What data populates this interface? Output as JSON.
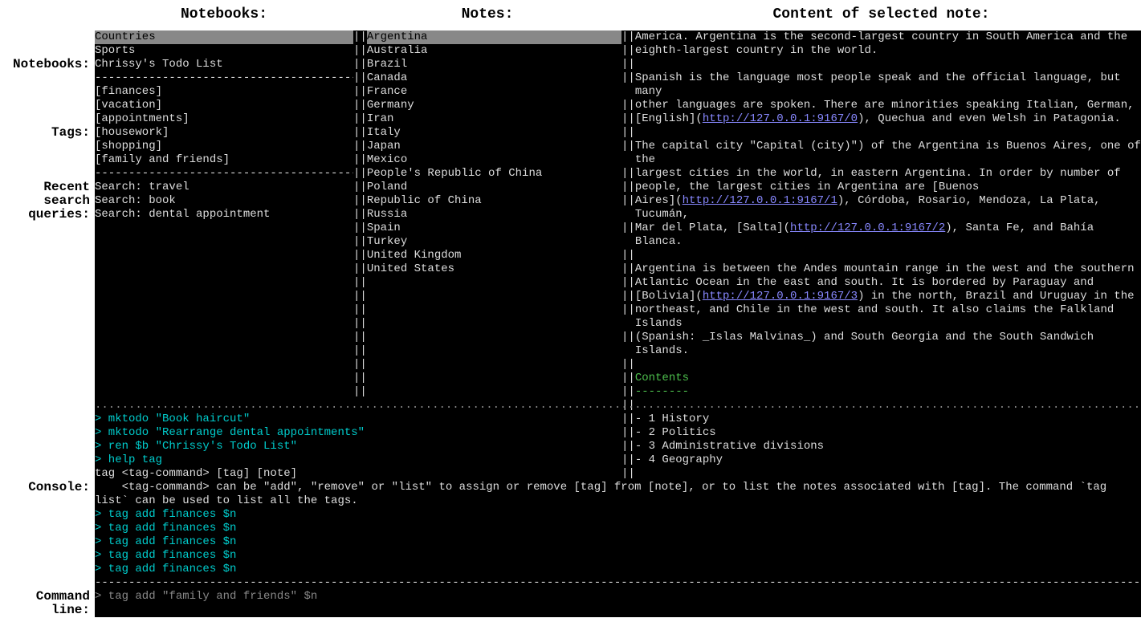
{
  "headers": {
    "notebooks": "Notebooks:",
    "notes": "Notes:",
    "content": "Content of selected note:"
  },
  "side_labels": {
    "notebooks": "Notebooks:",
    "tags": "Tags:",
    "recent1": "Recent",
    "recent2": "search",
    "recent3": "queries:",
    "console": "Console:",
    "cmd1": "Command",
    "cmd2": "line:"
  },
  "notebooks": [
    "Countries",
    "Sports",
    "Chrissy's Todo List"
  ],
  "tags": [
    "[finances]",
    "[vacation]",
    "[appointments]",
    "[housework]",
    "[shopping]",
    "[family and friends]"
  ],
  "searches": [
    "Search: travel",
    "Search: book",
    "Search: dental appointment"
  ],
  "notes": [
    "Argentina",
    "Australia",
    "Brazil",
    "Canada",
    "France",
    "Germany",
    "Iran",
    "Italy",
    "Japan",
    "Mexico",
    "People's Republic of China",
    "Poland",
    "Republic of China",
    "Russia",
    "Spain",
    "Turkey",
    "United Kingdom",
    "United States"
  ],
  "content": {
    "p1": "America. Argentina is the second-largest country in South America and the eighth-largest country in the world.",
    "p2a": "Spanish is the language most people speak and the official language, but many other languages are spoken. There are minorities speaking Italian, German, [English](",
    "link0": "http://127.0.0.1:9167/0",
    "p2b": "), Quechua and even Welsh in Patagonia.",
    "p3a": "The capital city \"Capital (city)\") of the Argentina is Buenos Aires, one of the largest cities in the world, in eastern Argentina. In order by number of people, the largest cities in Argentina are [Buenos Aires](",
    "link1": "http://127.0.0.1:9167/1",
    "p3b": "), Córdoba, Rosario, Mendoza, La Plata, Tucumán, Mar del Plata, [Salta](",
    "link2": "http://127.0.0.1:9167/2",
    "p3c": "), Santa Fe, and Bahía Blanca.",
    "p4a": "Argentina is between the Andes mountain range in the west and the southern Atlantic Ocean in the east and south. It is bordered by Paraguay and [Bolivia](",
    "link3": "http://127.0.0.1:9167/3",
    "p4b": ") in the north, Brazil and Uruguay in the northeast, and Chile in the west and south. It also claims the Falkland Islands (Spanish: _Islas Malvinas_) and South Georgia and the South Sandwich Islands.",
    "contents_head": "Contents",
    "contents_rule": "--------",
    "toc": [
      "- 1 History",
      "- 2 Politics",
      "- 3 Administrative divisions",
      "- 4 Geography"
    ]
  },
  "console": {
    "lines": [
      {
        "prompt": "> ",
        "cmd": "mktodo \"Book haircut\"",
        "cls": "cyan"
      },
      {
        "prompt": "> ",
        "cmd": "mktodo \"Rearrange dental appointments\"",
        "cls": "cyan"
      },
      {
        "prompt": "> ",
        "cmd": "ren $b \"Chrissy's Todo List\"",
        "cls": "cyan"
      },
      {
        "prompt": "> ",
        "cmd": "help tag",
        "cls": "cyan"
      }
    ],
    "help1": "tag <tag-command> [tag] [note]",
    "help2": "    <tag-command> can be \"add\", \"remove\" or \"list\" to assign or remove [tag] from [note], or to list the notes associated with [tag]. The command `tag list` can be used to list all the tags.",
    "tagadds": [
      "tag add finances $n",
      "tag add finances $n",
      "tag add finances $n",
      "tag add finances $n",
      "tag add finances $n"
    ]
  },
  "cmdline": {
    "prompt": "> ",
    "text": "tag add \"family and friends\" $n"
  },
  "dash": "----------------------------------------------------------------------------------------------------",
  "dot": "......................................................................................................................................................................................................................................................................................"
}
